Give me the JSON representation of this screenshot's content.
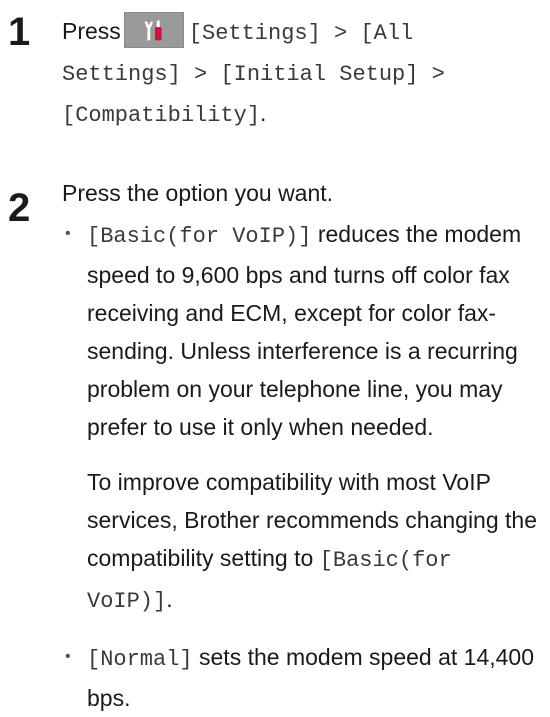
{
  "steps": [
    {
      "number": "1",
      "prefix": "Press",
      "icon": "settings-tools-icon",
      "path_1": "[Settings] > [All Settings] > [Initial Setup] > [Compatibility]",
      "path_end": "."
    },
    {
      "number": "2",
      "text": "Press the option you want.",
      "options": [
        {
          "code": "[Basic(for VoIP)]",
          "text": " reduces the modem speed to 9,600 bps and turns off color fax receiving and ECM, except for color fax-sending. Unless interference is a recurring problem on your telephone line, you may prefer to use it only when needed.",
          "note_text": "To improve compatibility with most VoIP services, Brother recommends changing the compatibility setting to ",
          "note_code": "[Basic(for VoIP)]",
          "note_end": "."
        },
        {
          "code": "[Normal]",
          "text": " sets the modem speed at 14,400 bps."
        }
      ]
    }
  ],
  "colors": {
    "icon_background": "#9a9a9a",
    "icon_red": "#d0103a",
    "icon_white": "#ffffff"
  }
}
